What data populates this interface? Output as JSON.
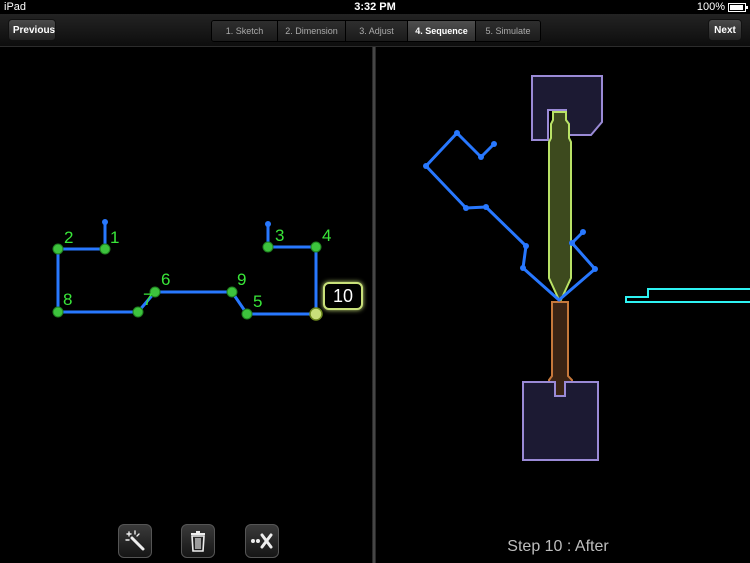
{
  "status": {
    "carrier": "iPad",
    "time": "3:32 PM",
    "battery": "100%",
    "battery_level": 1.0
  },
  "nav": {
    "previous_label": "Previous",
    "next_label": "Next",
    "tabs": [
      {
        "label": "1. Sketch",
        "active": false
      },
      {
        "label": "2. Dimension",
        "active": false
      },
      {
        "label": "3. Adjust",
        "active": false
      },
      {
        "label": "4. Sequence",
        "active": true
      },
      {
        "label": "5. Simulate",
        "active": false
      }
    ]
  },
  "sketch": {
    "labels": [
      "1",
      "2",
      "3",
      "4",
      "5",
      "6",
      "7",
      "8",
      "9"
    ],
    "current_step_badge": "10"
  },
  "toolbar": {
    "icons": [
      "magic-wand-icon",
      "trash-icon",
      "remove-bend-icon"
    ]
  },
  "preview": {
    "step_caption": "Step 10 : After"
  },
  "colors": {
    "line": "#2878ff",
    "node": "#3dc33d",
    "label": "#39e639",
    "punch": "#b9e266",
    "die": "#c6783b",
    "tooling": "#9a8ad6",
    "backgauge": "#2ef2f2",
    "callout_border": "#c9e07a"
  }
}
